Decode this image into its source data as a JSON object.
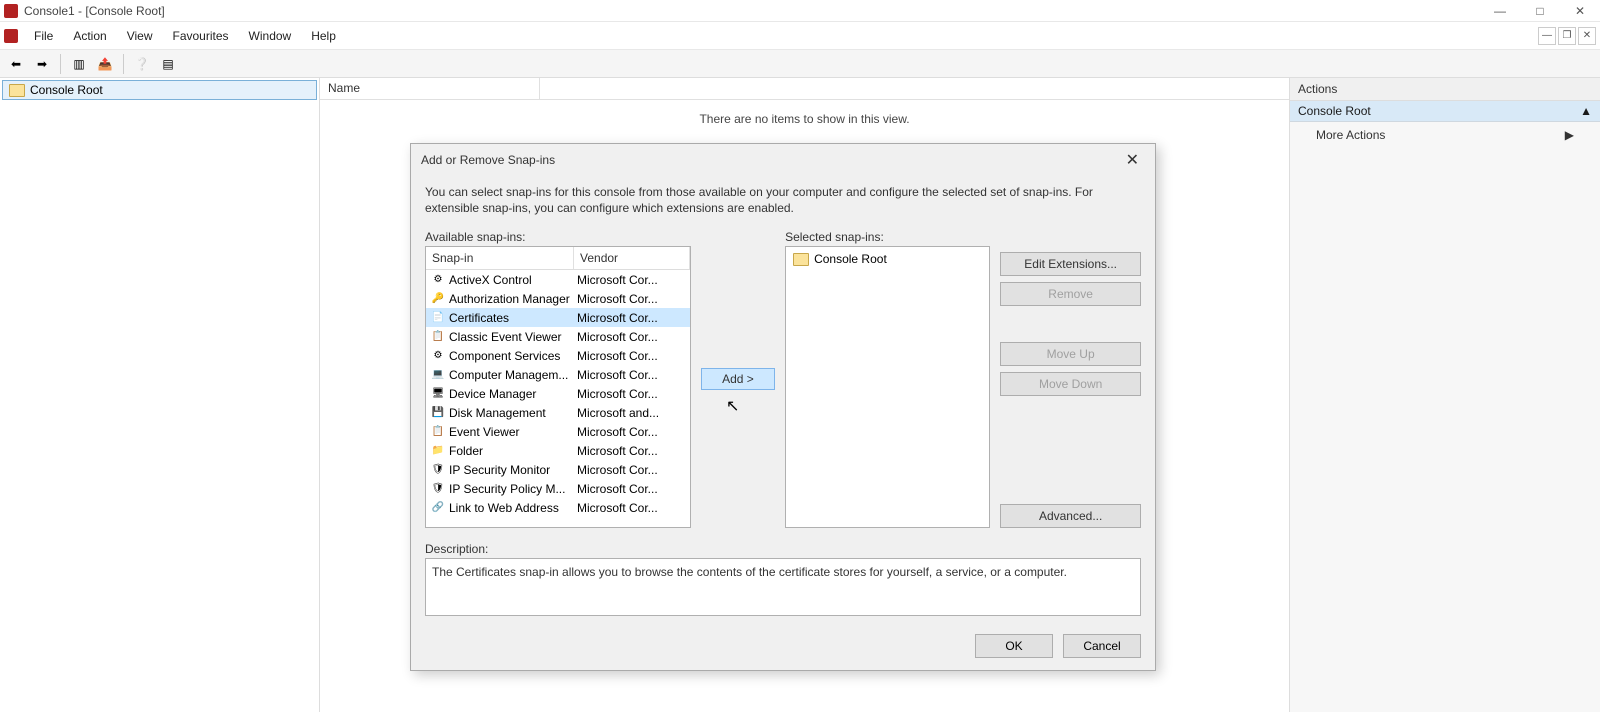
{
  "window": {
    "title": "Console1 - [Console Root]"
  },
  "menus": [
    "File",
    "Action",
    "View",
    "Favourites",
    "Window",
    "Help"
  ],
  "tree": {
    "root": "Console Root"
  },
  "list": {
    "header": "Name",
    "empty": "There are no items to show in this view."
  },
  "actions": {
    "title": "Actions",
    "sub": "Console Root",
    "more": "More Actions"
  },
  "dialog": {
    "title": "Add or Remove Snap-ins",
    "intro": "You can select snap-ins for this console from those available on your computer and configure the selected set of snap-ins. For extensible snap-ins, you can configure which extensions are enabled.",
    "available_label": "Available snap-ins:",
    "selected_label": "Selected snap-ins:",
    "col_snapin": "Snap-in",
    "col_vendor": "Vendor",
    "add": "Add >",
    "edit_ext": "Edit Extensions...",
    "remove": "Remove",
    "move_up": "Move Up",
    "move_down": "Move Down",
    "advanced": "Advanced...",
    "desc_label": "Description:",
    "desc_text": "The Certificates snap-in allows you to browse the contents of the certificate stores for yourself, a service, or a computer.",
    "ok": "OK",
    "cancel": "Cancel",
    "selected_root": "Console Root",
    "snapins": [
      {
        "name": "ActiveX Control",
        "vendor": "Microsoft Cor...",
        "icon": "⚙"
      },
      {
        "name": "Authorization Manager",
        "vendor": "Microsoft Cor...",
        "icon": "🔑"
      },
      {
        "name": "Certificates",
        "vendor": "Microsoft Cor...",
        "icon": "📄",
        "selected": true
      },
      {
        "name": "Classic Event Viewer",
        "vendor": "Microsoft Cor...",
        "icon": "📋"
      },
      {
        "name": "Component Services",
        "vendor": "Microsoft Cor...",
        "icon": "⚙"
      },
      {
        "name": "Computer Managem...",
        "vendor": "Microsoft Cor...",
        "icon": "💻"
      },
      {
        "name": "Device Manager",
        "vendor": "Microsoft Cor...",
        "icon": "🖥"
      },
      {
        "name": "Disk Management",
        "vendor": "Microsoft and...",
        "icon": "💾"
      },
      {
        "name": "Event Viewer",
        "vendor": "Microsoft Cor...",
        "icon": "📋"
      },
      {
        "name": "Folder",
        "vendor": "Microsoft Cor...",
        "icon": "📁"
      },
      {
        "name": "IP Security Monitor",
        "vendor": "Microsoft Cor...",
        "icon": "🛡"
      },
      {
        "name": "IP Security Policy M...",
        "vendor": "Microsoft Cor...",
        "icon": "🛡"
      },
      {
        "name": "Link to Web Address",
        "vendor": "Microsoft Cor...",
        "icon": "🔗"
      }
    ]
  }
}
